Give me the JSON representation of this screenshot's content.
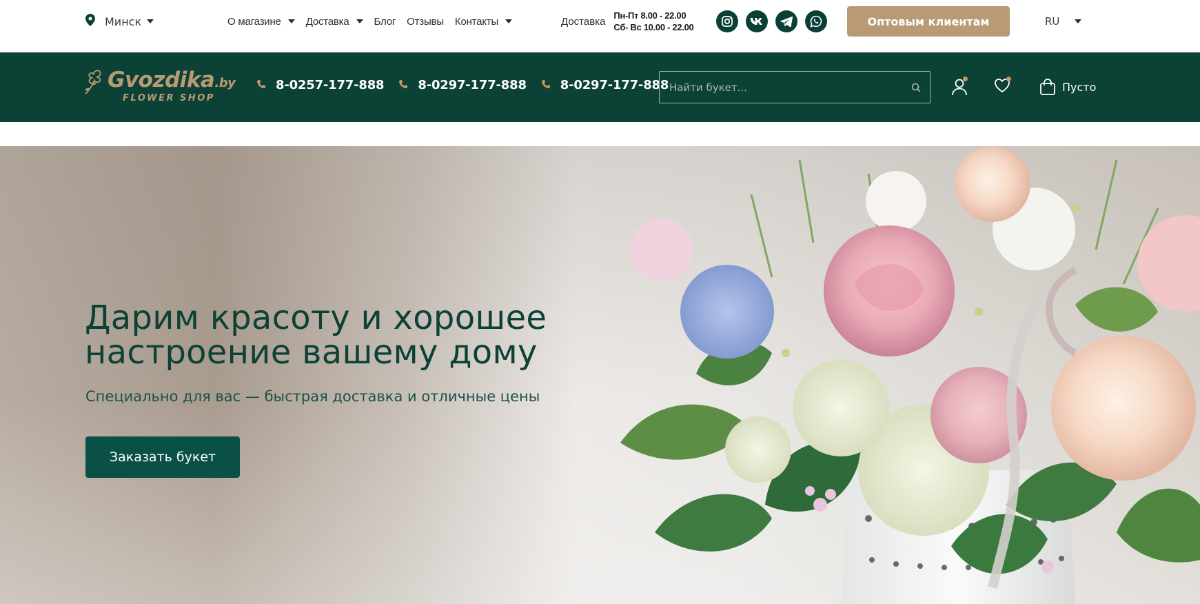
{
  "topbar": {
    "city": "Минск",
    "nav": [
      {
        "label": "О магазине",
        "has_dropdown": true
      },
      {
        "label": "Доставка",
        "has_dropdown": true
      },
      {
        "label": "Блог",
        "has_dropdown": false
      },
      {
        "label": "Отзывы",
        "has_dropdown": false
      },
      {
        "label": "Контакты",
        "has_dropdown": true
      }
    ],
    "delivery_label": "Доставка",
    "hours_weekdays": "Пн-Пт 8.00 - 22.00",
    "hours_weekend": "Сб- Вс 10.00 - 22.00",
    "socials": [
      "instagram-icon",
      "vk-icon",
      "telegram-icon",
      "whatsapp-icon"
    ],
    "wholesale_button": "Оптовым клиентам",
    "language": "RU"
  },
  "header": {
    "logo_word": "Gvozdika",
    "logo_tld": ".by",
    "logo_sub": "FLOWER  SHOP",
    "phones": [
      "8-0257-177-888",
      "8-0297-177-888",
      "8-0297-177-888"
    ],
    "search_placeholder": "Найти букет...",
    "cart_label": "Пусто"
  },
  "hero": {
    "title": "Дарим красоту и хорошее настроение вашему дому",
    "subtitle": "Специально для вас — быстрая доставка и отличные цены",
    "cta": "Заказать букет"
  },
  "colors": {
    "brand_green": "#0c4136",
    "button_green": "#0a5046",
    "accent_gold": "#b89a74",
    "badge_dot": "#c59a62"
  }
}
